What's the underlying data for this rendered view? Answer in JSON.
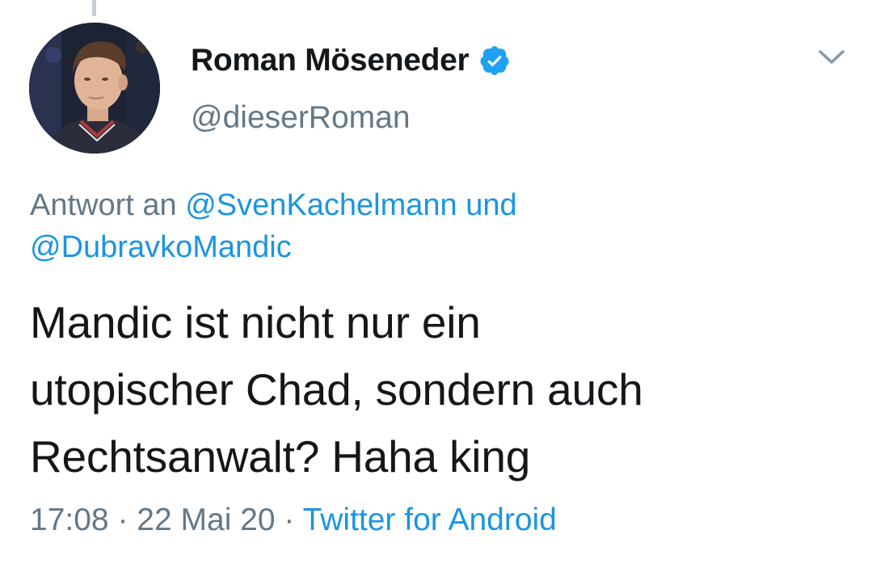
{
  "author": {
    "display_name": "Roman Möseneder",
    "handle": "@dieserRoman",
    "verified": true
  },
  "reply_context": {
    "prefix": "Antwort an",
    "mention_1": "@SvenKachelmann",
    "conjunction": "und",
    "mention_2": "@DubravkoMandic"
  },
  "tweet": {
    "line_1": "Mandic ist nicht nur ein",
    "line_2": "utopischer Chad, sondern auch",
    "line_3": "Rechtsanwalt? Haha king"
  },
  "meta": {
    "time": "17:08",
    "separator": "·",
    "date": "22 Mai 20",
    "source": "Twitter for Android"
  },
  "icons": {
    "verified": "verified-badge-icon",
    "menu": "chevron-down-icon"
  },
  "colors": {
    "text_primary": "#14171a",
    "text_secondary": "#657786",
    "link": "#1b95e0",
    "verified": "#1da1f2"
  }
}
